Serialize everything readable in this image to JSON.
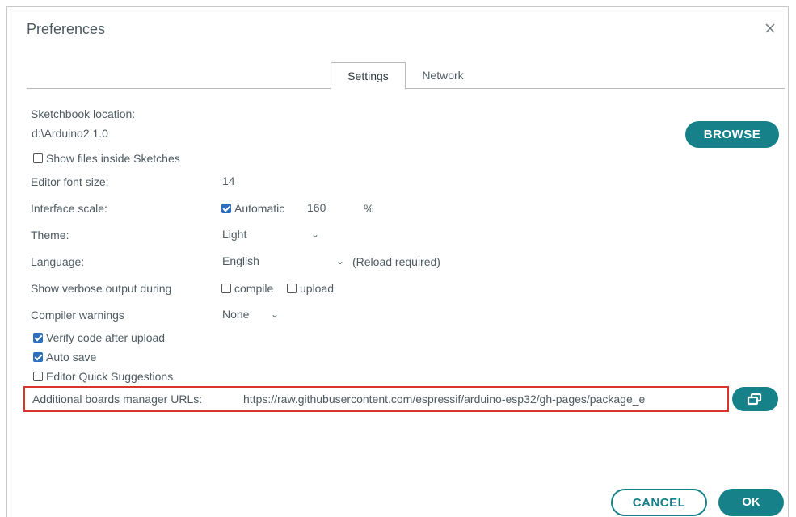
{
  "dialog": {
    "title": "Preferences"
  },
  "tabs": [
    {
      "label": "Settings",
      "active": true
    },
    {
      "label": "Network",
      "active": false
    }
  ],
  "settings": {
    "sketchbook_label": "Sketchbook location:",
    "sketchbook_value": "d:\\Arduino2.1.0",
    "browse_label": "BROWSE",
    "show_files_label": "Show files inside Sketches",
    "show_files_checked": false,
    "font_size_label": "Editor font size:",
    "font_size_value": "14",
    "interface_scale_label": "Interface scale:",
    "automatic_label": "Automatic",
    "automatic_checked": true,
    "scale_value": "160",
    "scale_unit": "%",
    "theme_label": "Theme:",
    "theme_value": "Light",
    "language_label": "Language:",
    "language_value": "English",
    "reload_note": "(Reload required)",
    "verbose_label": "Show verbose output during",
    "compile_label": "compile",
    "compile_checked": false,
    "upload_label": "upload",
    "upload_checked": false,
    "compiler_warnings_label": "Compiler warnings",
    "compiler_warnings_value": "None",
    "verify_label": "Verify code after upload",
    "verify_checked": true,
    "autosave_label": "Auto save",
    "autosave_checked": true,
    "quick_suggestions_label": "Editor Quick Suggestions",
    "quick_suggestions_checked": false,
    "urls_label": "Additional boards manager URLs:",
    "urls_value": "https://raw.githubusercontent.com/espressif/arduino-esp32/gh-pages/package_e"
  },
  "footer": {
    "cancel_label": "CANCEL",
    "ok_label": "OK"
  },
  "colors": {
    "accent": "#17818a",
    "highlight_border": "#d9352c",
    "checkbox_checked": "#2c6fbf"
  },
  "icons": {
    "close": "close-icon",
    "open_editor": "open-editor-icon",
    "chevron": "chevron-down-icon"
  }
}
